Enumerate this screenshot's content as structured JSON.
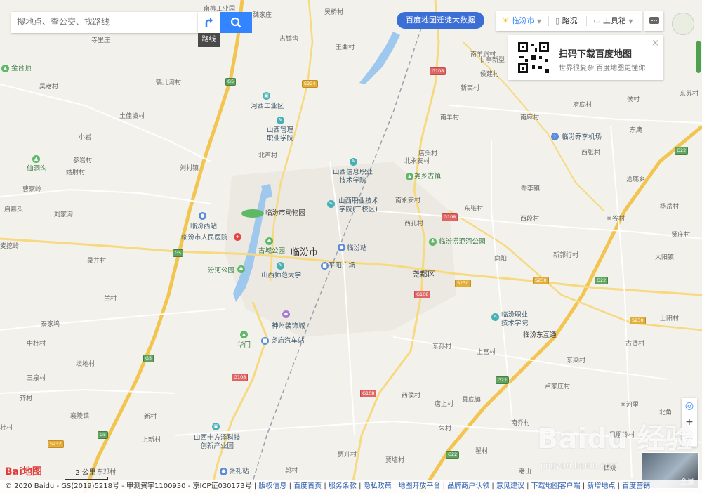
{
  "search": {
    "placeholder": "搜地点、查公交、找路线",
    "route_tip": "路线"
  },
  "banner": "百度地图迁徙大数据",
  "toolbar": {
    "city": "临汾市",
    "traffic": "路况",
    "tools": "工具箱"
  },
  "qr_card": {
    "title": "扫码下载百度地图",
    "subtitle": "世界很复杂,百度地图更懂你",
    "close": "×"
  },
  "zoom": {
    "locate": "◎",
    "in": "+",
    "out": "−"
  },
  "pano_label": "全景",
  "logo": "Bai地图",
  "scale_label": "2 公里",
  "watermark": {
    "main": "Baidu 经验",
    "sub": "jingyan.baidu.com"
  },
  "footer": {
    "copyright": "© 2020 Baidu - GS(2019)5218号 - 甲测资字1100930 - 京ICP证030173号",
    "links": [
      "版权信息",
      "百度首页",
      "服务条款",
      "隐私政策",
      "地图开放平台",
      "品牌商户认领",
      "意见建议",
      "下载地图客户端",
      "新增地点",
      "百度营销"
    ]
  },
  "map": {
    "city_labels": [
      {
        "text": "临汾市",
        "size": "big"
      },
      {
        "text": "尧都区",
        "size": "mid"
      }
    ],
    "pois": [
      {
        "name": "河西工业区",
        "icon": "building-icon",
        "color": "teal"
      },
      {
        "name": "山西管理\n职业学院",
        "icon": "school-icon",
        "color": "teal"
      },
      {
        "name": "山西信息职业\n技术学院",
        "icon": "school-icon",
        "color": "teal"
      },
      {
        "name": "山西职业技术\n学院(二校区)",
        "icon": "school-icon",
        "color": "teal"
      },
      {
        "name": "临汾市动物园",
        "icon": "zoo-icon",
        "color": "green"
      },
      {
        "name": "临汾西站",
        "icon": "station-icon",
        "color": "blue"
      },
      {
        "name": "临汾市人民医院",
        "icon": "hospital-icon",
        "color": "red"
      },
      {
        "name": "古城公园",
        "icon": "park-icon",
        "color": "green"
      },
      {
        "name": "汾河公园",
        "icon": "park-icon",
        "color": "green"
      },
      {
        "name": "山西师范大学",
        "icon": "school-icon",
        "color": "teal"
      },
      {
        "name": "临汾站",
        "icon": "station-icon",
        "color": "blue"
      },
      {
        "name": "平阳广场",
        "icon": "square-icon",
        "color": "blue"
      },
      {
        "name": "尧乡古镇",
        "icon": "scenic-icon",
        "color": "green"
      },
      {
        "name": "临汾涝洰河公园",
        "icon": "park-icon",
        "color": "green"
      },
      {
        "name": "临汾乔李机场",
        "icon": "airport-icon",
        "color": "blue"
      },
      {
        "name": "临汾职业\n技术学院",
        "icon": "school-icon",
        "color": "teal"
      },
      {
        "name": "临汾东互通",
        "icon": "",
        "color": ""
      },
      {
        "name": "神州装饰城",
        "icon": "shop-icon",
        "color": "purple"
      },
      {
        "name": "华门",
        "icon": "scenic-icon",
        "color": "green"
      },
      {
        "name": "尧庙汽车站",
        "icon": "bus-icon",
        "color": "blue"
      },
      {
        "name": "山西十方泽科技\n创新产业园",
        "icon": "building-icon",
        "color": "teal"
      },
      {
        "name": "张礼站",
        "icon": "station-icon",
        "color": "blue"
      },
      {
        "name": "金台顶",
        "icon": "scenic-icon",
        "color": "green"
      },
      {
        "name": "仙洞沟",
        "icon": "scenic-icon",
        "color": "green"
      }
    ],
    "place_labels": [
      "南柳工业园",
      "魏家庄",
      "吴桥村",
      "古镇沟",
      "王曲村",
      "寺里庄",
      "南羊涧村",
      "甘亭新型",
      "侯建村",
      "新高村",
      "吴老村",
      "鹤儿沟村",
      "府底村",
      "南羊村",
      "南麻村",
      "侯村",
      "东苏村",
      "土佳坡村",
      "小岩",
      "北芦村",
      "东鹰",
      "西张村",
      "参岩村",
      "刘村镇",
      "店头村",
      "北永安村",
      "沧底乡",
      "姑射村",
      "曹家岭",
      "南永安村",
      "乔李镇",
      "启慕头",
      "刘家沟",
      "东张村",
      "杨岳村",
      "西孔村",
      "西段村",
      "南谷村",
      "贤庄村",
      "麦挖岭",
      "新郭行村",
      "向阳",
      "大阳镇",
      "录井村",
      "兰村",
      "泰家坞",
      "上阳村",
      "中杜村",
      "古贤村",
      "东孙村",
      "上宫村",
      "东梁村",
      "坛地村",
      "三泉村",
      "卢家庄村",
      "西侯村",
      "齐村",
      "店上村",
      "县底镇",
      "南河里",
      "北角",
      "襄陵镇",
      "新村",
      "朱村",
      "南乔村",
      "杜村",
      "上新村",
      "凤凰岭村",
      "贾升村",
      "翟村",
      "东邓村",
      "郭村",
      "贾墙村",
      "老山",
      "西姚"
    ],
    "road_shields": [
      {
        "text": "G5",
        "type": "g"
      },
      {
        "text": "G5",
        "type": "g"
      },
      {
        "text": "G5",
        "type": "g"
      },
      {
        "text": "G5",
        "type": "g"
      },
      {
        "text": "S224",
        "type": "y"
      },
      {
        "text": "G108",
        "type": "r"
      },
      {
        "text": "G108",
        "type": "r"
      },
      {
        "text": "G108",
        "type": "r"
      },
      {
        "text": "G108",
        "type": "r"
      },
      {
        "text": "G108",
        "type": "r"
      },
      {
        "text": "S230",
        "type": "y"
      },
      {
        "text": "S230",
        "type": "y"
      },
      {
        "text": "S230",
        "type": "y"
      },
      {
        "text": "G22",
        "type": "g"
      },
      {
        "text": "G22",
        "type": "g"
      },
      {
        "text": "G22",
        "type": "g"
      },
      {
        "text": "G22",
        "type": "g"
      },
      {
        "text": "S232",
        "type": "y"
      }
    ]
  }
}
